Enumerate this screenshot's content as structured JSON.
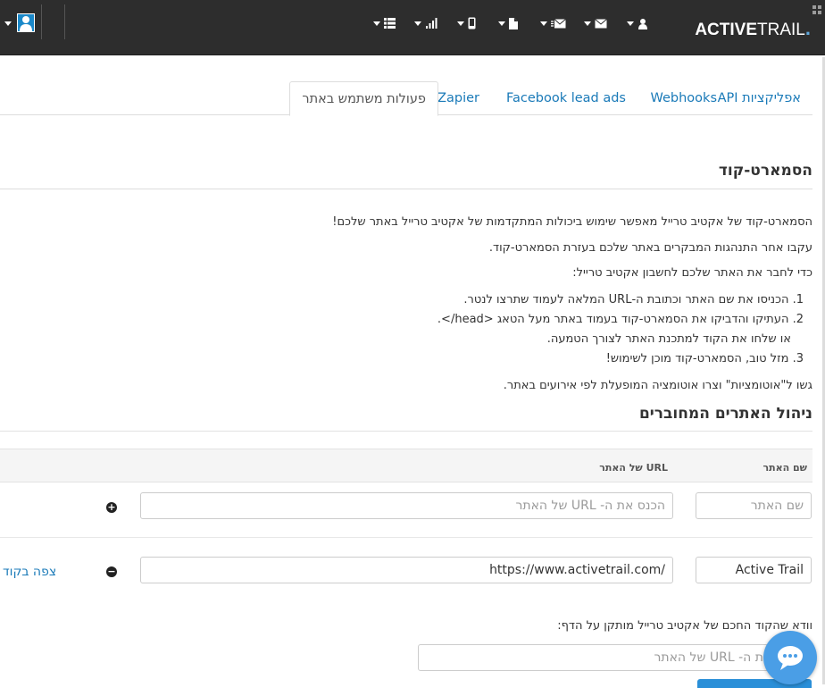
{
  "header": {
    "logo_main": "ACTIVE",
    "logo_rest": "TRAIL",
    "logo_dot": "."
  },
  "tabs": [
    {
      "label": "אפליקציות API"
    },
    {
      "label": "Webhooks"
    },
    {
      "label": "Facebook lead ads"
    },
    {
      "label": "Zapier"
    },
    {
      "label": "פעולות משתמש באתר"
    }
  ],
  "smartcode": {
    "title": "הסמארט-קוד",
    "intro": "הסמארט-קוד של אקטיב טרייל מאפשר שימוש ביכולות המתקדמות של אקטיב טרייל באתר שלכם!",
    "track": "עקבו אחר התנהגות המבקרים באתר שלכם בעזרת הסמארט-קוד.",
    "connect": "כדי לחבר את האתר שלכם לחשבון אקטיב טרייל:",
    "step1": "1. הכניסו את שם האתר וכתובת ה-URL המלאה לעמוד שתרצו לנטר.",
    "step2": "2. העתיקו והדביקו את הסמארט-קוד בעמוד באתר מעל הטאג <head/>.",
    "step2b": "או שלחו את הקוד למתכנת האתר לצורך הטמעה.",
    "step3": "3. מזל טוב, הסמארט-קוד מוכן לשימוש!",
    "automation": "גשו ל\"אוטומציות\" וצרו אוטומציה המופעלת לפי אירועים באתר."
  },
  "sites": {
    "title": "ניהול האתרים המחוברים",
    "col_name": "שם האתר",
    "col_url": "URL של האתר",
    "new_name_placeholder": "שם האתר",
    "new_url_placeholder": "הכנס את ה- URL של האתר",
    "rows": [
      {
        "name": "Active Trail",
        "url": "https://www.activetrail.com/",
        "action": "צפה בקוד"
      }
    ]
  },
  "verify": {
    "text": "וודא שהקוד החכם של אקטיב טרייל מותקן על הדף:",
    "placeholder": "הכנס את ה- URL של האתר"
  }
}
